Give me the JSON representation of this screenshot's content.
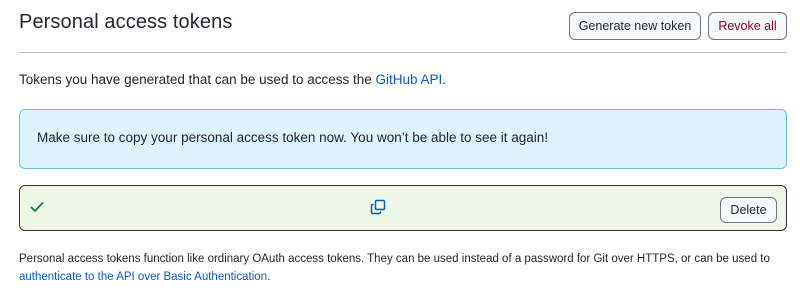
{
  "header": {
    "title": "Personal access tokens",
    "generate_button": "Generate new token",
    "revoke_button": "Revoke all"
  },
  "intro": {
    "text": "Tokens you have generated that can be used to access the ",
    "link": "GitHub API",
    "suffix": "."
  },
  "flash": {
    "message": "Make sure to copy your personal access token now. You won’t be able to see it again!"
  },
  "token": {
    "status_icon": "check-icon",
    "copy_icon": "copy-icon",
    "delete_button": "Delete"
  },
  "footer": {
    "text": "Personal access tokens function like ordinary OAuth access tokens. They can be used instead of a password for Git over HTTPS, or can be used to ",
    "link": "authenticate to the API over Basic Authentication",
    "suffix": "."
  },
  "colors": {
    "info_bg": "#ddf4ff",
    "success_bg": "#eef6e8",
    "link": "#0a59c4",
    "danger": "#82071e",
    "check": "#1a7f37",
    "copy_icon": "#0a59c4"
  }
}
